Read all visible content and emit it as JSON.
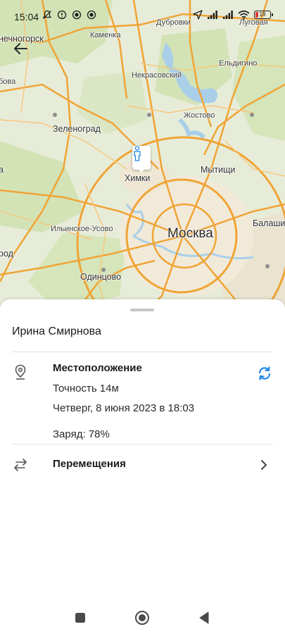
{
  "status_bar": {
    "time": "15:04",
    "battery_level": "19",
    "left_icons": [
      "mute-icon",
      "alert-icon",
      "record-icon",
      "record-icon"
    ],
    "right_icons": [
      "location-arrow-icon",
      "cell-signal-icon",
      "cell-signal-icon",
      "wifi-icon",
      "battery-icon"
    ]
  },
  "map": {
    "labels": [
      {
        "id": "solnechnogorsk",
        "text": "нечногорск",
        "kind": "city"
      },
      {
        "id": "dubrovki",
        "text": "Дубровки",
        "kind": "town"
      },
      {
        "id": "lugovaya",
        "text": "Луговая",
        "kind": "town"
      },
      {
        "id": "kamenka",
        "text": "Каменка",
        "kind": "town"
      },
      {
        "id": "nekrasovskiy",
        "text": "Некрасовский",
        "kind": "town"
      },
      {
        "id": "eldigino",
        "text": "Ельдигино",
        "kind": "town"
      },
      {
        "id": "bova",
        "text": "бова",
        "kind": "town"
      },
      {
        "id": "zhostovo",
        "text": "Жостово",
        "kind": "town"
      },
      {
        "id": "zelenograd",
        "text": "Зеленоград",
        "kind": "city"
      },
      {
        "id": "mytishchi",
        "text": "Мытищи",
        "kind": "city"
      },
      {
        "id": "khimki",
        "text": "Химки",
        "kind": "city"
      },
      {
        "id": "left-a",
        "text": "а",
        "kind": "city"
      },
      {
        "id": "moskva",
        "text": "Москва",
        "kind": "capital"
      },
      {
        "id": "balashikha",
        "text": "Балаши",
        "kind": "city"
      },
      {
        "id": "ilinskoe-usovo",
        "text": "Ильинское-Усово",
        "kind": "town"
      },
      {
        "id": "gorod",
        "text": "род",
        "kind": "city"
      },
      {
        "id": "odintsovo",
        "text": "Одинцово",
        "kind": "city"
      }
    ]
  },
  "contact": {
    "name": "Ирина Смирнова"
  },
  "location": {
    "title": "Местоположение",
    "accuracy": "Точность 14м",
    "datetime": "Четверг, 8 июня 2023 в 18:03",
    "battery": "Заряд: 78%"
  },
  "movements": {
    "title": "Перемещения"
  },
  "colors": {
    "accent": "#1e88e5",
    "road": "#f2a93b",
    "water": "#a9cfe8",
    "forest": "#cfe0b0"
  }
}
